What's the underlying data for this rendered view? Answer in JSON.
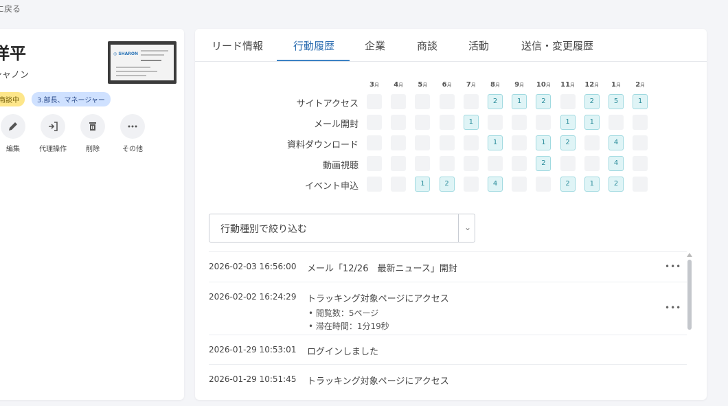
{
  "back_link": "に戻る",
  "profile": {
    "name": "洋平",
    "company": "シャノン",
    "badges": [
      "商談中",
      "3.部長、マネージャー"
    ],
    "actions": [
      {
        "label": "編集",
        "icon": "pencil-icon"
      },
      {
        "label": "代理操作",
        "icon": "login-icon"
      },
      {
        "label": "削除",
        "icon": "trash-icon"
      },
      {
        "label": "その他",
        "icon": "more-icon"
      }
    ]
  },
  "tabs": [
    "リード情報",
    "行動履歴",
    "企業",
    "商談",
    "活動",
    "送信・変更履歴"
  ],
  "active_tab": "行動履歴",
  "heatmap": {
    "months": [
      "3",
      "4",
      "5",
      "6",
      "7",
      "8",
      "9",
      "10",
      "11",
      "12",
      "1",
      "2"
    ],
    "month_unit": "月",
    "rows": [
      {
        "label": "サイトアクセス",
        "values": [
          0,
          0,
          0,
          0,
          0,
          2,
          1,
          2,
          0,
          2,
          5,
          1
        ]
      },
      {
        "label": "メール開封",
        "values": [
          0,
          0,
          0,
          0,
          1,
          0,
          0,
          0,
          1,
          1,
          0,
          0
        ]
      },
      {
        "label": "資料ダウンロード",
        "values": [
          0,
          0,
          0,
          0,
          0,
          1,
          0,
          1,
          2,
          0,
          4,
          0
        ]
      },
      {
        "label": "動画視聴",
        "values": [
          0,
          0,
          0,
          0,
          0,
          0,
          0,
          2,
          0,
          0,
          4,
          0
        ]
      },
      {
        "label": "イベント申込",
        "values": [
          0,
          0,
          1,
          2,
          0,
          4,
          0,
          0,
          2,
          1,
          2,
          0
        ]
      }
    ]
  },
  "filter": {
    "placeholder": "行動種別で絞り込む"
  },
  "activities": [
    {
      "time": "2026-02-03 16:56:00",
      "title": "メール「12/26　最新ニュース」開封",
      "details": []
    },
    {
      "time": "2026-02-02 16:24:29",
      "title": "トラッキング対象ページにアクセス",
      "details": [
        "閲覧数：5ページ",
        "滞在時間：1分19秒"
      ]
    },
    {
      "time": "2026-01-29 10:53:01",
      "title": "ログインしました",
      "details": []
    },
    {
      "time": "2026-01-29 10:51:45",
      "title": "トラッキング対象ページにアクセス",
      "details": []
    }
  ],
  "more_label": "•••",
  "chevron": "⌄"
}
